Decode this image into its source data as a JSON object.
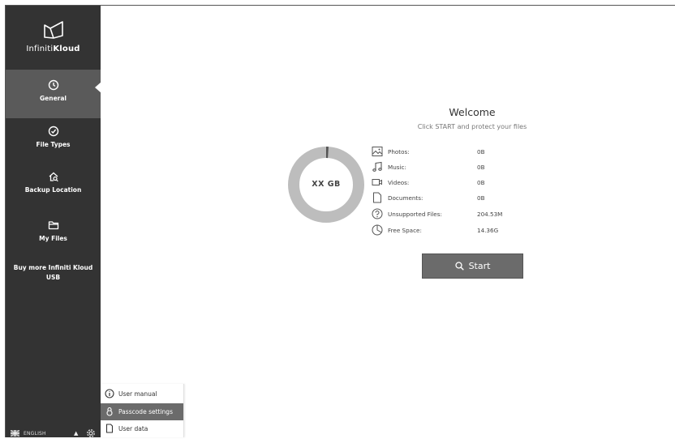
{
  "app": {
    "brand_light": "Infiniti",
    "brand_bold": "Kloud"
  },
  "sidebar": {
    "items": [
      {
        "label": "General",
        "icon": "clock-icon",
        "active": true
      },
      {
        "label": "File Types",
        "icon": "check-circle-icon",
        "active": false
      },
      {
        "label": "Backup Location",
        "icon": "home-search-icon",
        "active": false
      },
      {
        "label": "My Files",
        "icon": "folder-icon",
        "active": false
      }
    ],
    "promo": "Buy more Infiniti Kloud USB"
  },
  "footer": {
    "language": "ENGLISH"
  },
  "settings_menu": {
    "items": [
      {
        "label": "User manual",
        "icon": "info-icon",
        "active": false
      },
      {
        "label": "Passcode settings",
        "icon": "lock-icon",
        "active": true
      },
      {
        "label": "User data",
        "icon": "document-icon",
        "active": false
      }
    ]
  },
  "main": {
    "title": "Welcome",
    "subtitle": "Click START and protect your files",
    "donut_label": "XX GB",
    "storage_used_fraction": 0.01,
    "stats": [
      {
        "name": "Photos:",
        "value": "0B",
        "icon": "image-icon"
      },
      {
        "name": "Music:",
        "value": "0B",
        "icon": "music-icon"
      },
      {
        "name": "Videos:",
        "value": "0B",
        "icon": "video-icon"
      },
      {
        "name": "Documents:",
        "value": "0B",
        "icon": "document-icon"
      },
      {
        "name": "Unsupported Files:",
        "value": "204.53M",
        "icon": "question-icon"
      },
      {
        "name": "Free Space:",
        "value": "14.36G",
        "icon": "pie-icon"
      }
    ],
    "start_label": "Start"
  },
  "colors": {
    "sidebar_bg": "#333333",
    "sidebar_active": "#5a5a5a",
    "button_bg": "#6b6b6b",
    "donut_track": "#bdbdbd",
    "donut_used": "#555555"
  }
}
